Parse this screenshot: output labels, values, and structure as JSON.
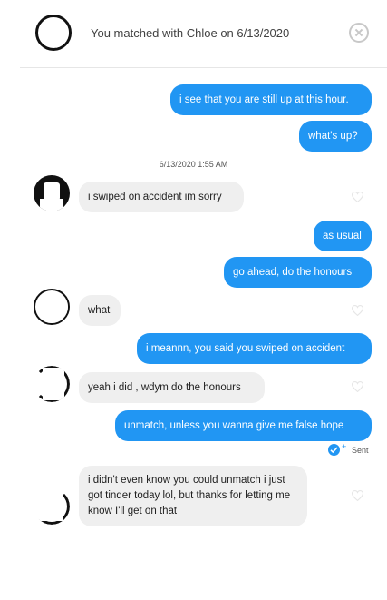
{
  "header": {
    "title": "You matched with Chloe on 6/13/2020",
    "close_icon": "close-circle-icon"
  },
  "timestamp": "6/13/2020 1:55 AM",
  "messages": [
    {
      "from": "me",
      "text": "i see that you are still up at this hour."
    },
    {
      "from": "me",
      "text": "what's up?"
    },
    {
      "from": "them",
      "text": "i swiped on accident im sorry"
    },
    {
      "from": "me",
      "text": "as usual"
    },
    {
      "from": "me",
      "text": "go ahead, do the honours"
    },
    {
      "from": "them",
      "text": "what"
    },
    {
      "from": "me",
      "text": "i meannn, you said you swiped on accident"
    },
    {
      "from": "them",
      "text": "yeah i did , wdym do the honours"
    },
    {
      "from": "me",
      "text": "unmatch, unless you wanna give me false hope"
    },
    {
      "from": "them",
      "text": "i didn't even know you could unmatch i just got tinder today lol, but thanks for letting me know I'll get on that"
    }
  ],
  "status": {
    "sent_label": "Sent",
    "icon": "double-check-icon"
  },
  "icons": {
    "like": "heart-outline-icon"
  },
  "colors": {
    "sent_bubble": "#2196f3",
    "received_bubble": "#efefef"
  }
}
